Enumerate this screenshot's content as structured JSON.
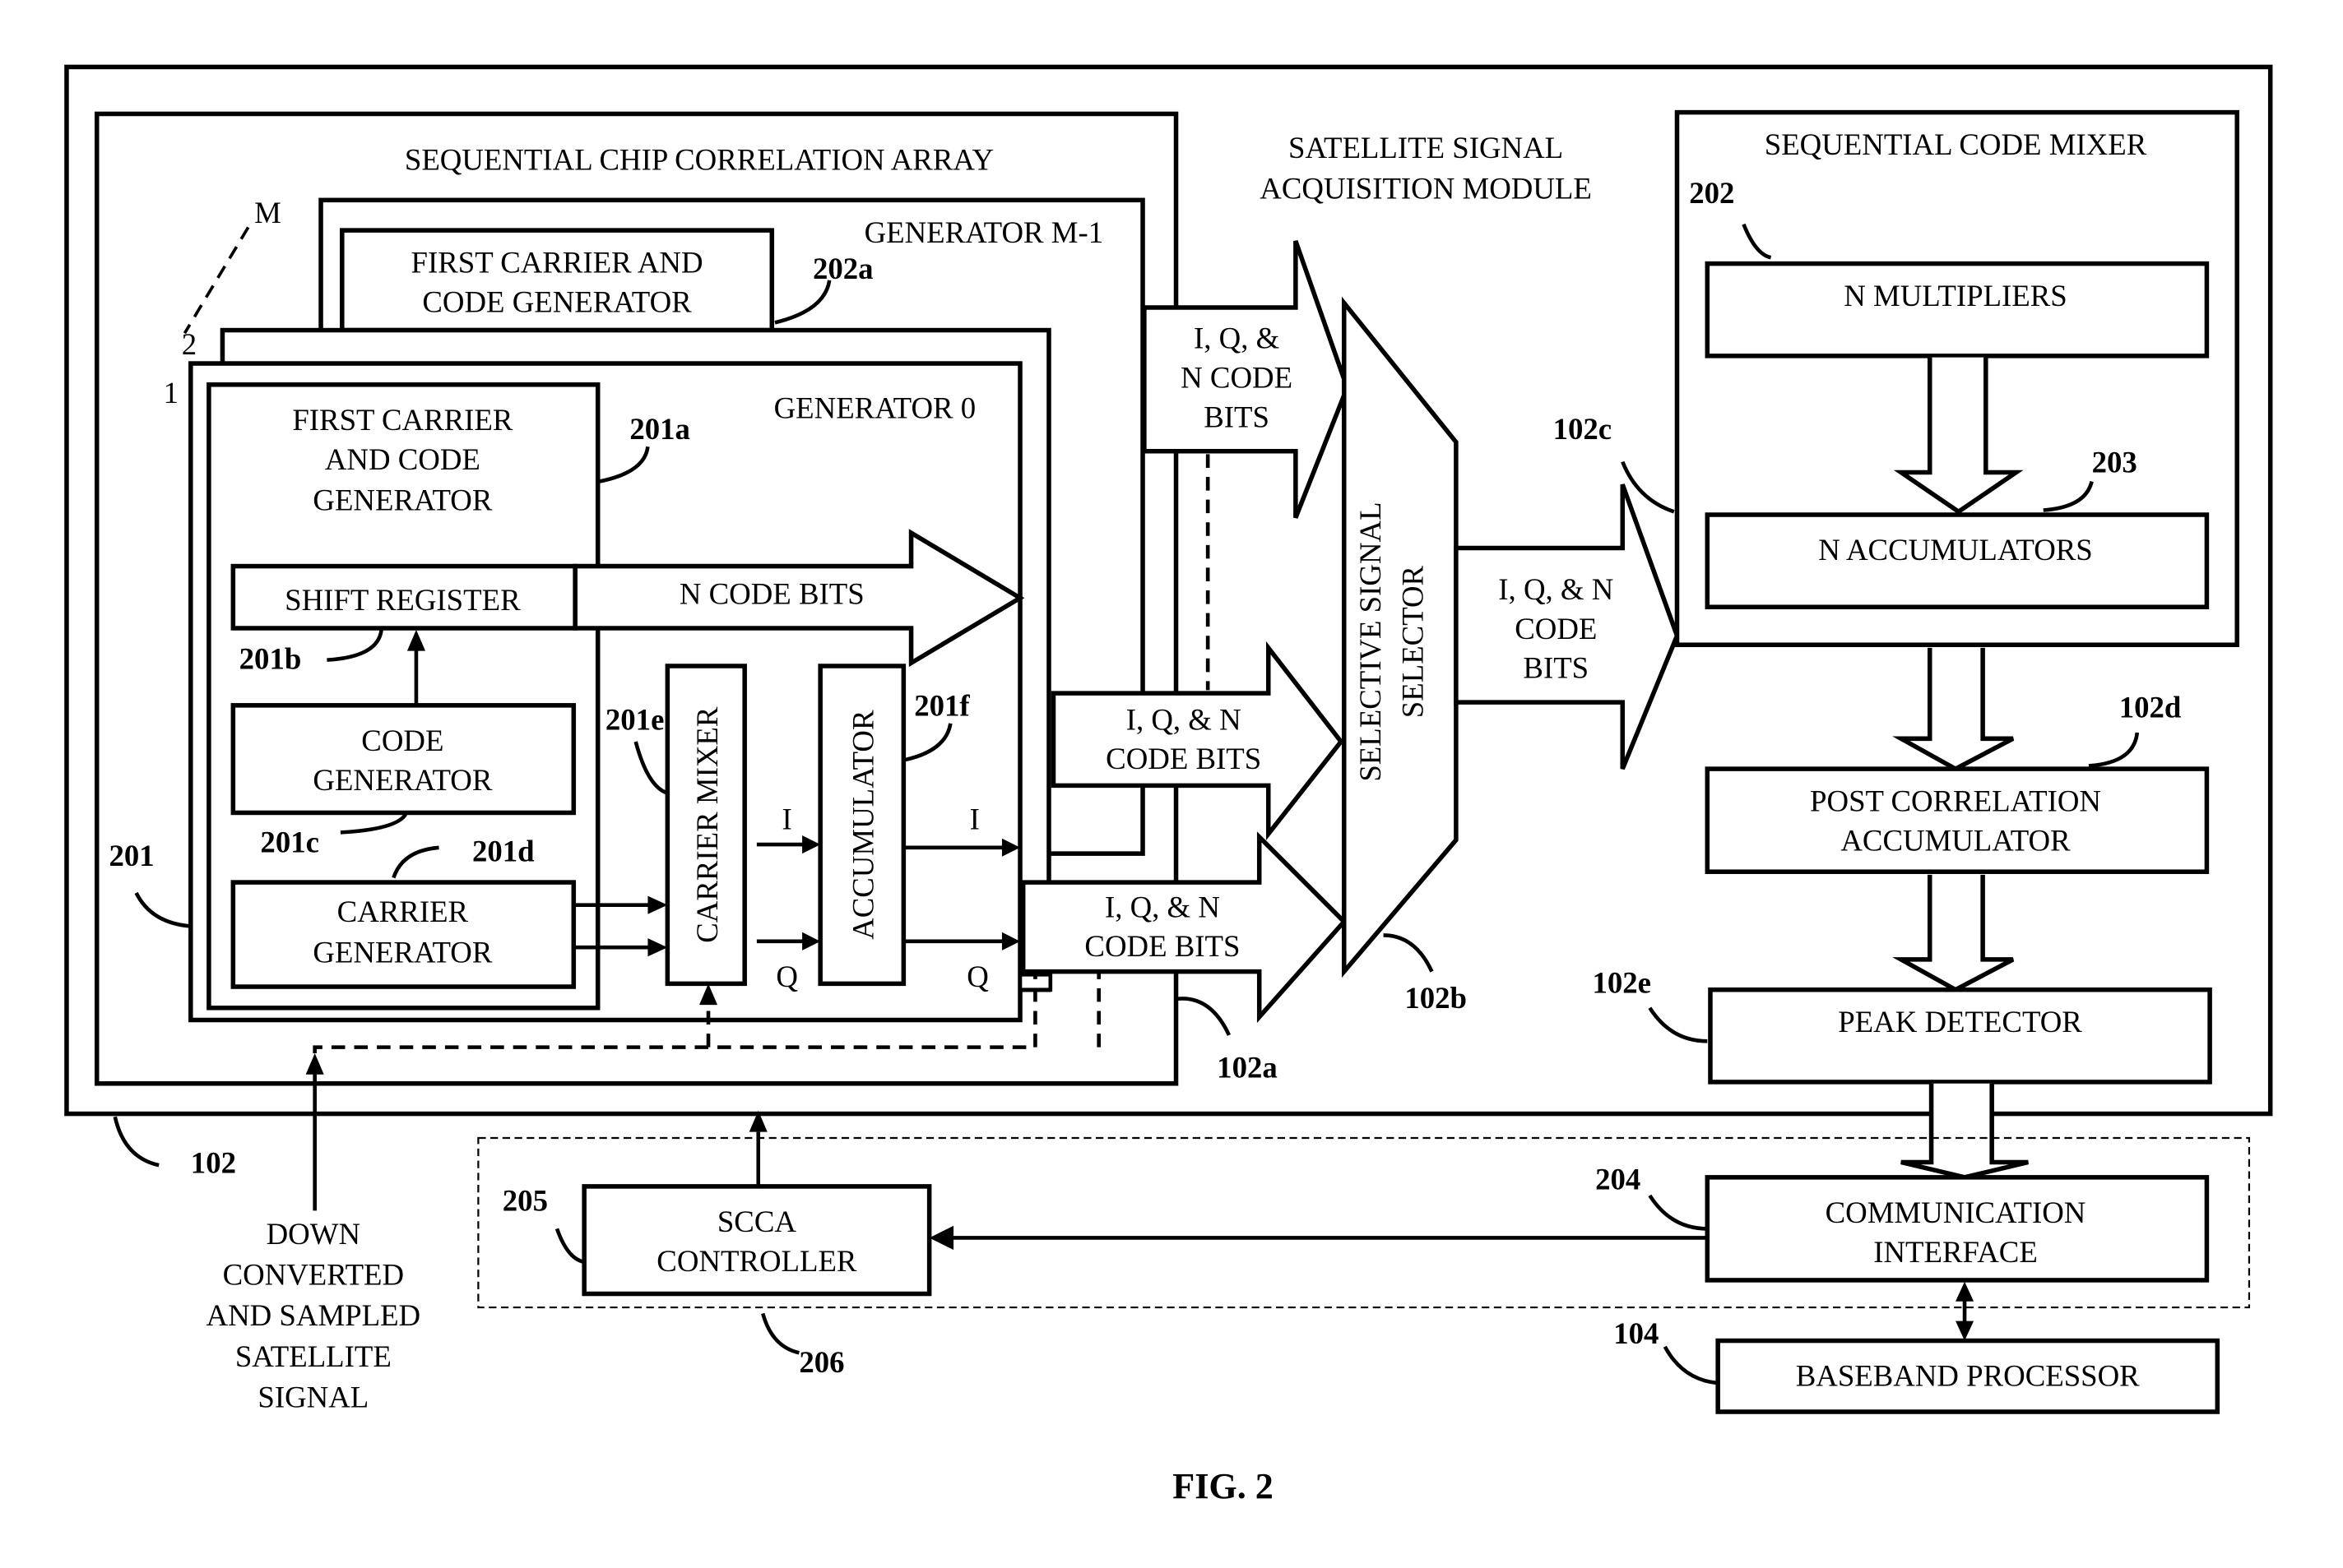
{
  "figure_caption": "FIG. 2",
  "module": {
    "title_line1": "SATELLITE SIGNAL",
    "title_line2": "ACQUISITION MODULE",
    "ref": "102"
  },
  "scca": {
    "title": "SEQUENTIAL CHIP CORRELATION ARRAY",
    "ref": "102a",
    "stack_labels": {
      "m": "M",
      "two": "2",
      "one": "1"
    },
    "generator_m1": {
      "title": "GENERATOR M-1",
      "first_gen_line1": "FIRST CARRIER AND",
      "first_gen_line2": "CODE GENERATOR",
      "first_gen_ref": "202a"
    },
    "generator_0": {
      "title": "GENERATOR 0",
      "ref": "201",
      "first_gen_line1": "FIRST CARRIER",
      "first_gen_line2": "AND CODE",
      "first_gen_line3": "GENERATOR",
      "first_gen_ref": "201a",
      "shift_register": "SHIFT REGISTER",
      "shift_register_ref": "201b",
      "n_code_bits": "N CODE BITS",
      "code_gen_line1": "CODE",
      "code_gen_line2": "GENERATOR",
      "code_gen_ref": "201c",
      "carrier_gen_line1": "CARRIER",
      "carrier_gen_line2": "GENERATOR",
      "carrier_gen_ref": "201d",
      "carrier_mixer": "CARRIER MIXER",
      "carrier_mixer_ref": "201e",
      "accumulator": "ACCUMULATOR",
      "accumulator_ref": "201f",
      "i_label": "I",
      "q_label": "Q"
    }
  },
  "arrows": {
    "top_line1": "I, Q, &",
    "top_line2": "N CODE",
    "top_line3": "BITS",
    "mid_line1": "I, Q, & N",
    "mid_line2": "CODE BITS",
    "bot_line1": "I, Q, & N",
    "bot_line2": "CODE BITS",
    "out_line1": "I, Q, & N",
    "out_line2": "CODE",
    "out_line3": "BITS"
  },
  "selector": {
    "line1": "SELECTIVE SIGNAL",
    "line2": "SELECTOR",
    "ref": "102b"
  },
  "code_mixer": {
    "title": "SEQUENTIAL CODE MIXER",
    "ref": "102c",
    "multipliers": "N MULTIPLIERS",
    "multipliers_ref": "202",
    "accumulators": "N ACCUMULATORS",
    "accumulators_ref": "203"
  },
  "post_corr": {
    "line1": "POST CORRELATION",
    "line2": "ACCUMULATOR",
    "ref": "102d"
  },
  "peak": {
    "label": "PEAK DETECTOR",
    "ref": "102e"
  },
  "comm": {
    "line1": "COMMUNICATION",
    "line2": "INTERFACE",
    "ref": "204"
  },
  "controller": {
    "line1": "SCCA",
    "line2": "CONTROLLER",
    "ref": "205",
    "group_ref": "206"
  },
  "baseband": {
    "label": "BASEBAND PROCESSOR",
    "ref": "104"
  },
  "input_signal": {
    "line1": "DOWN",
    "line2": "CONVERTED",
    "line3": "AND SAMPLED",
    "line4": "SATELLITE",
    "line5": "SIGNAL"
  }
}
